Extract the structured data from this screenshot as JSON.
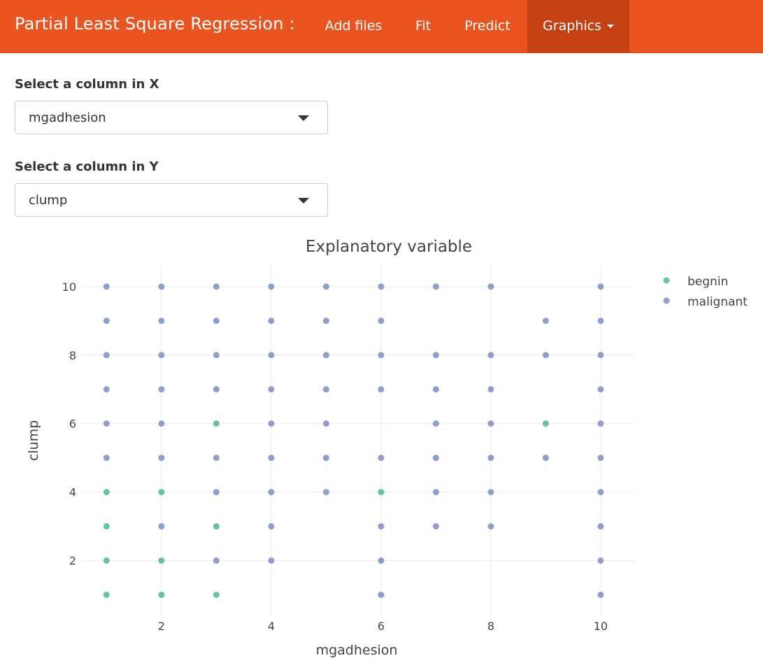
{
  "navbar": {
    "brand": "Partial Least Square Regression :",
    "items": [
      {
        "label": "Add files"
      },
      {
        "label": "Fit"
      },
      {
        "label": "Predict"
      },
      {
        "label": "Graphics"
      }
    ]
  },
  "controls": {
    "x_select": {
      "label": "Select a column in X",
      "value": "mgadhesion"
    },
    "y_select": {
      "label": "Select a column in Y",
      "value": "clump"
    }
  },
  "colors": {
    "navbar": "#e95420",
    "navbar_active": "#c34113",
    "begnin": "#66c2a5",
    "malignant": "#8da0cb"
  },
  "chart_data": {
    "type": "scatter",
    "title": "Explanatory variable",
    "xlabel": "mgadhesion",
    "ylabel": "clump",
    "x_ticks": [
      "2",
      "4",
      "6",
      "8",
      "10"
    ],
    "y_ticks": [
      "2",
      "4",
      "6",
      "8",
      "10"
    ],
    "xlim": [
      0.55,
      10.6
    ],
    "ylim": [
      0.4,
      10.65
    ],
    "grid": true,
    "legend_position": "top-right",
    "series": [
      {
        "name": "begnin",
        "color": "#66c2a5",
        "points": [
          [
            1,
            1
          ],
          [
            1,
            2
          ],
          [
            1,
            3
          ],
          [
            1,
            4
          ],
          [
            2,
            1
          ],
          [
            2,
            2
          ],
          [
            2,
            4
          ],
          [
            3,
            1
          ],
          [
            3,
            3
          ],
          [
            3,
            6
          ],
          [
            6,
            4
          ],
          [
            9,
            6
          ]
        ]
      },
      {
        "name": "malignant",
        "color": "#8da0cb",
        "points": [
          [
            1,
            5
          ],
          [
            1,
            6
          ],
          [
            1,
            7
          ],
          [
            1,
            8
          ],
          [
            1,
            9
          ],
          [
            1,
            10
          ],
          [
            2,
            3
          ],
          [
            2,
            5
          ],
          [
            2,
            6
          ],
          [
            2,
            7
          ],
          [
            2,
            8
          ],
          [
            2,
            9
          ],
          [
            2,
            10
          ],
          [
            3,
            2
          ],
          [
            3,
            4
          ],
          [
            3,
            5
          ],
          [
            3,
            7
          ],
          [
            3,
            8
          ],
          [
            3,
            9
          ],
          [
            3,
            10
          ],
          [
            4,
            2
          ],
          [
            4,
            3
          ],
          [
            4,
            4
          ],
          [
            4,
            5
          ],
          [
            4,
            6
          ],
          [
            4,
            7
          ],
          [
            4,
            8
          ],
          [
            4,
            9
          ],
          [
            4,
            10
          ],
          [
            5,
            4
          ],
          [
            5,
            5
          ],
          [
            5,
            6
          ],
          [
            5,
            7
          ],
          [
            5,
            8
          ],
          [
            5,
            9
          ],
          [
            5,
            10
          ],
          [
            6,
            1
          ],
          [
            6,
            2
          ],
          [
            6,
            3
          ],
          [
            6,
            5
          ],
          [
            6,
            7
          ],
          [
            6,
            8
          ],
          [
            6,
            9
          ],
          [
            6,
            10
          ],
          [
            7,
            3
          ],
          [
            7,
            4
          ],
          [
            7,
            5
          ],
          [
            7,
            6
          ],
          [
            7,
            7
          ],
          [
            7,
            8
          ],
          [
            7,
            10
          ],
          [
            8,
            3
          ],
          [
            8,
            4
          ],
          [
            8,
            5
          ],
          [
            8,
            6
          ],
          [
            8,
            7
          ],
          [
            8,
            8
          ],
          [
            8,
            10
          ],
          [
            9,
            5
          ],
          [
            9,
            8
          ],
          [
            9,
            9
          ],
          [
            10,
            1
          ],
          [
            10,
            2
          ],
          [
            10,
            3
          ],
          [
            10,
            4
          ],
          [
            10,
            5
          ],
          [
            10,
            6
          ],
          [
            10,
            7
          ],
          [
            10,
            8
          ],
          [
            10,
            9
          ],
          [
            10,
            10
          ]
        ]
      }
    ]
  }
}
